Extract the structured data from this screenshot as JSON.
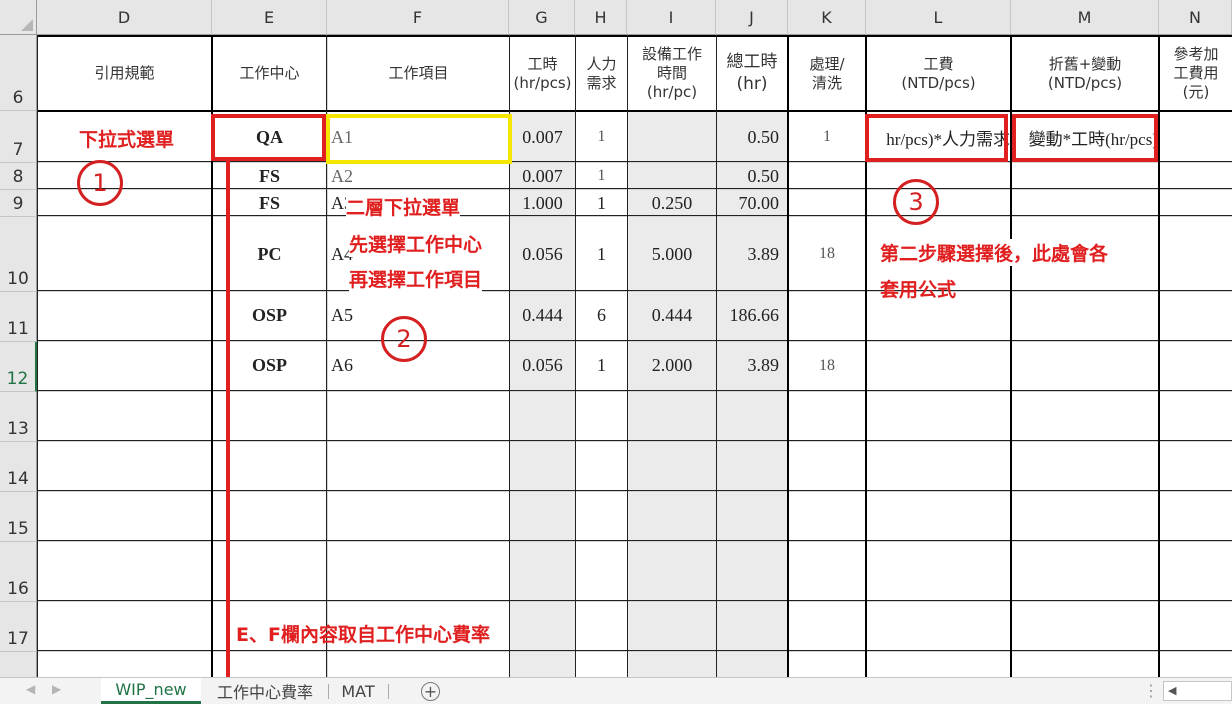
{
  "columns": [
    {
      "letter": "D",
      "header": "引用規範"
    },
    {
      "letter": "E",
      "header": "工作中心"
    },
    {
      "letter": "F",
      "header": "工作項目"
    },
    {
      "letter": "G",
      "header": "工時\n(hr/pcs)"
    },
    {
      "letter": "H",
      "header": "人力\n需求"
    },
    {
      "letter": "I",
      "header": "設備工作\n時間\n(hr/pc)"
    },
    {
      "letter": "J",
      "header": "總工時\n(hr)"
    },
    {
      "letter": "K",
      "header": "處理/\n清洗"
    },
    {
      "letter": "L",
      "header": "工費\n(NTD/pcs)"
    },
    {
      "letter": "M",
      "header": "折舊+變動\n(NTD/pcs)"
    },
    {
      "letter": "N",
      "header": "參考加\n工費用\n(元)"
    }
  ],
  "row_numbers": [
    "6",
    "7",
    "8",
    "9",
    "10",
    "11",
    "12",
    "13",
    "14",
    "15",
    "16",
    "17"
  ],
  "rows": [
    {
      "e": "QA",
      "f": "A1",
      "g": "0.007",
      "h": "1",
      "i": "",
      "j": "0.50",
      "k": "1",
      "l": "hr/pcs)*人力需求",
      "m": "變動*工時(hr/pcs)"
    },
    {
      "e": "FS",
      "f": "A2",
      "g": "0.007",
      "h": "1",
      "i": "",
      "j": "0.50",
      "k": "",
      "l": "",
      "m": ""
    },
    {
      "e": "FS",
      "f": "A3",
      "g": "1.000",
      "h": "1",
      "i": "0.250",
      "j": "70.00",
      "k": "",
      "l": "",
      "m": ""
    },
    {
      "e": "PC",
      "f": "A4",
      "g": "0.056",
      "h": "1",
      "i": "5.000",
      "j": "3.89",
      "k": "18",
      "l": "",
      "m": ""
    },
    {
      "e": "OSP",
      "f": "A5",
      "g": "0.444",
      "h": "6",
      "i": "0.444",
      "j": "186.66",
      "k": "",
      "l": "",
      "m": ""
    },
    {
      "e": "OSP",
      "f": "A6",
      "g": "0.056",
      "h": "1",
      "i": "2.000",
      "j": "3.89",
      "k": "18",
      "l": "",
      "m": ""
    }
  ],
  "annotations": {
    "dropdown": "下拉式選單",
    "two_level_dropdown": "二層下拉選單",
    "select_center_first": "先選擇工作中心",
    "then_select_item": "再選擇工作項目",
    "step3_line1": "第二步驟選擇後，此處會各",
    "step3_line2": "套用公式",
    "source_note": "E、F欄內容取自工作中心費率",
    "circle1": "1",
    "circle2": "2",
    "circle3": "3"
  },
  "sheet_tabs": [
    "WIP_new",
    "工作中心費率",
    "MAT"
  ],
  "add_sheet_icon": "plus-circle-icon",
  "colors": {
    "annotation_red": "#e02020",
    "highlight_yellow": "#f5e600",
    "active_tab_green": "#217346",
    "shaded_cell": "#ebebeb"
  }
}
